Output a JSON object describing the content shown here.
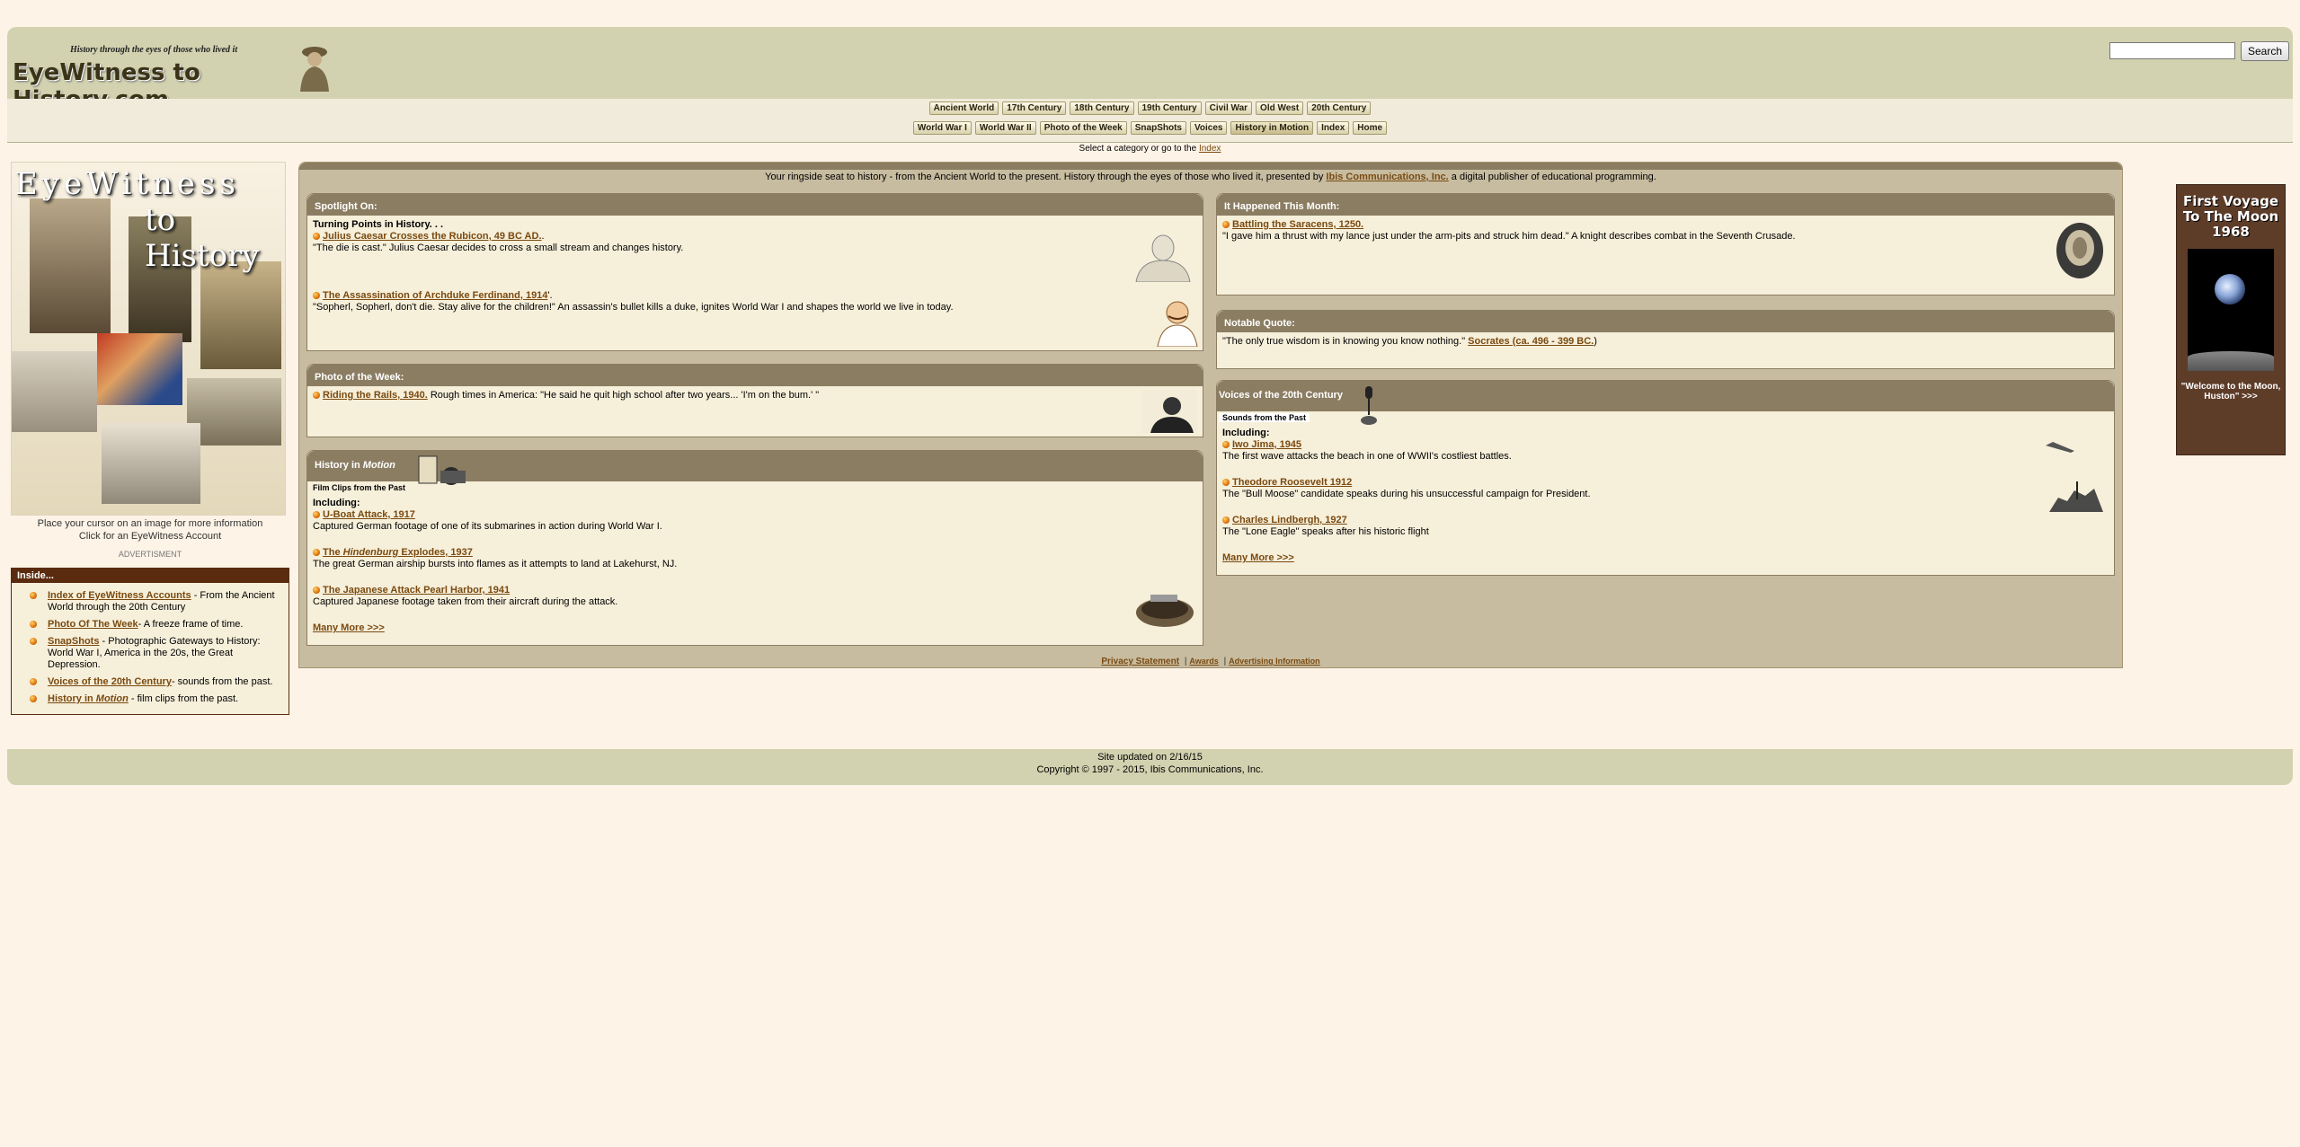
{
  "header": {
    "tagline": "History through the eyes of those who lived it",
    "logo_text": "EyeWitness to History.com",
    "search_placeholder": "",
    "search_button": "Search"
  },
  "nav": {
    "row1": [
      "Ancient World",
      "17th Century",
      "18th Century",
      "19th Century",
      "Civil War",
      "Old West",
      "20th Century"
    ],
    "row2": [
      "World War I",
      "World War II",
      "Photo of the Week",
      "SnapShots",
      "Voices",
      "History in Motion",
      "Index",
      "Home"
    ],
    "active": "History in Motion",
    "sub_text": "Select a category or go to the",
    "sub_link": "Index"
  },
  "left": {
    "collage_title1": "EyeWitness",
    "collage_title2": "to History",
    "caption1": "Place your cursor on an image for more information",
    "caption2": "Click for an EyeWitness Account",
    "advert_label": "ADVERTISMENT",
    "inside_title": "Inside...",
    "inside_items": [
      {
        "link": "Index of EyeWitness Accounts",
        "text": " - From the Ancient World through the 20th Century"
      },
      {
        "link": "Photo Of The Week",
        "text": "- A freeze frame of time."
      },
      {
        "link": "SnapShots",
        "text": " - Photographic Gateways to History: World War I, America in the 20s, the Great Depression."
      },
      {
        "link": "Voices of the 20th Century",
        "text": "- sounds from the past."
      },
      {
        "link_pre": "History in ",
        "link_em": "Motion",
        "text": " - film clips from the past."
      }
    ]
  },
  "main": {
    "intro_pre": "Your ringside seat to history - from the Ancient World to the present. History through the eyes of those who lived it, presented by ",
    "intro_link": "Ibis Communications, Inc.",
    "intro_post": " a digital publisher of educational programming.",
    "spotlight": {
      "title": "Spotlight On:",
      "subtitle": "Turning Points in History. . .",
      "item1_link": "Julius Caesar Crosses the Rubicon, 49 BC AD.",
      "item1_text": "\"The die is cast.\" Julius Caesar decides to cross a small stream and changes history.",
      "item2_link": "The Assassination of Archduke Ferdinand, 1914",
      "item2_text": "\"Sopherl, Sopherl, don't die. Stay alive for the children!\" An assassin's bullet kills a duke, ignites World War I and shapes the world we live in today."
    },
    "photo_week": {
      "title": "Photo of the Week:",
      "link": "Riding the Rails, 1940.",
      "text": " Rough times in America: \"He said he quit high school after two years... 'I'm on the bum.' \""
    },
    "history_motion": {
      "title_pre": "History in ",
      "title_em": "Motion",
      "sub": "Film Clips from the Past",
      "including": "Including:",
      "items": [
        {
          "link": "U-Boat Attack, 1917",
          "text": "Captured German footage of one of its submarines in action during World War I."
        },
        {
          "link_pre": "The ",
          "link_em": "Hindenburg",
          "link_post": " Explodes, 1937",
          "text": "The great German airship bursts into flames as it attempts to land at Lakehurst, NJ."
        },
        {
          "link": "The Japanese Attack Pearl Harbor, 1941",
          "text": "Captured Japanese footage taken from their aircraft during the attack."
        }
      ],
      "more": "Many More >>>"
    },
    "happened": {
      "title": "It Happened This Month:",
      "link": "Battling the Saracens, 1250.",
      "text": "\"I gave him a thrust with my lance just under the arm-pits and struck him dead.\" A knight describes combat in the Seventh Crusade."
    },
    "quote": {
      "title": "Notable Quote:",
      "text": "\"The only true wisdom is in knowing you know nothing.\" ",
      "link": "Socrates (ca. 496 - 399 BC.",
      "post": ")"
    },
    "voices": {
      "title": "Voices of the 20th Century",
      "sub": "Sounds from the Past",
      "including": "Including:",
      "items": [
        {
          "link": "Iwo Jima, 1945",
          "text": "The first wave attacks the beach in one of WWII's costliest battles."
        },
        {
          "link": "Theodore Roosevelt 1912",
          "text": "The \"Bull Moose\" candidate speaks during his unsuccessful campaign for President."
        },
        {
          "link": "Charles Lindbergh, 1927",
          "text": "The \"Lone Eagle\" speaks after his historic flight"
        }
      ],
      "more": "Many More >>>"
    },
    "footer_links": [
      "Privacy Statement",
      "Awards",
      "Advertising Information"
    ]
  },
  "ad": {
    "title": "First Voyage To The Moon 1968",
    "caption": "\"Welcome to the Moon, Huston\" >>>"
  },
  "site_footer": {
    "updated": "Site updated on 2/16/15",
    "copyright": "Copyright © 1997 - 2015, Ibis Communications, Inc."
  },
  "colors": {
    "header_bg": "#d2d2b0",
    "panel_header": "#8b7d62",
    "link": "#7a4a10",
    "page_bg": "#fdf3e7"
  }
}
